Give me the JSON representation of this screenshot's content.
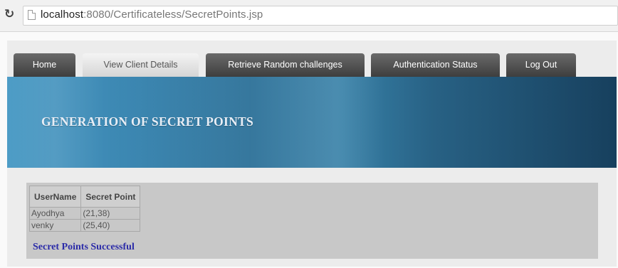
{
  "browser": {
    "url_host": "localhost",
    "url_rest": ":8080/Certificateless/SecretPoints.jsp"
  },
  "nav": {
    "tabs": [
      "Home",
      "View Client Details",
      "Retrieve Random challenges",
      "Authentication Status",
      "Log Out"
    ],
    "active": "View Client Details"
  },
  "banner": {
    "title": "GENERATION OF SECRET POINTS"
  },
  "table": {
    "headers": [
      "UserName",
      "Secret Point"
    ],
    "rows": [
      [
        "Ayodhya",
        "(21,38)"
      ],
      [
        "venky",
        "(25,40)"
      ]
    ]
  },
  "status_message": "Secret Points Successful",
  "colors": {
    "nav_tab": "#4f4f4f",
    "nav_tab_active": "#e3e3e3",
    "banner": "#2a6f97",
    "message": "#2b2ba8"
  }
}
